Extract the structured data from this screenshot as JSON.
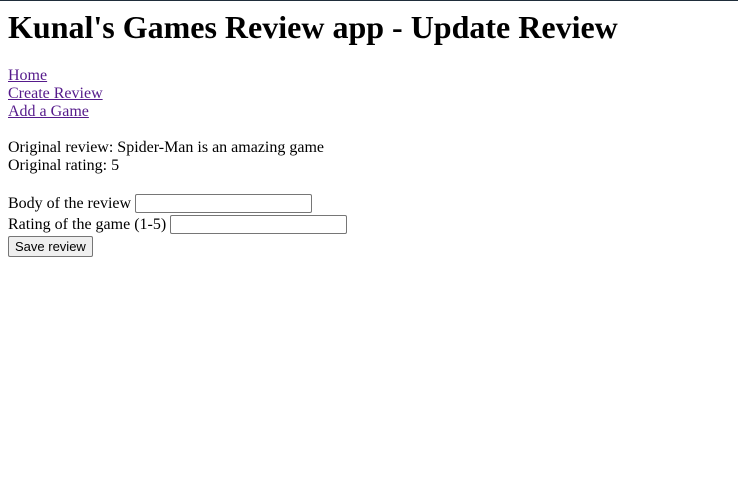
{
  "header": {
    "title": "Kunal's Games Review app - Update Review"
  },
  "nav": {
    "links": [
      {
        "label": "Home"
      },
      {
        "label": "Create Review"
      },
      {
        "label": "Add a Game"
      }
    ]
  },
  "original": {
    "review_text": "Original review: Spider-Man is an amazing game",
    "rating_text": "Original rating: 5"
  },
  "form": {
    "body_label": "Body of the review",
    "body_value": "",
    "rating_label": "Rating of the game (1-5)",
    "rating_value": "",
    "save_label": "Save review"
  },
  "colors": {
    "visited_link": "#551a8b",
    "text": "#000000",
    "background": "#ffffff"
  }
}
